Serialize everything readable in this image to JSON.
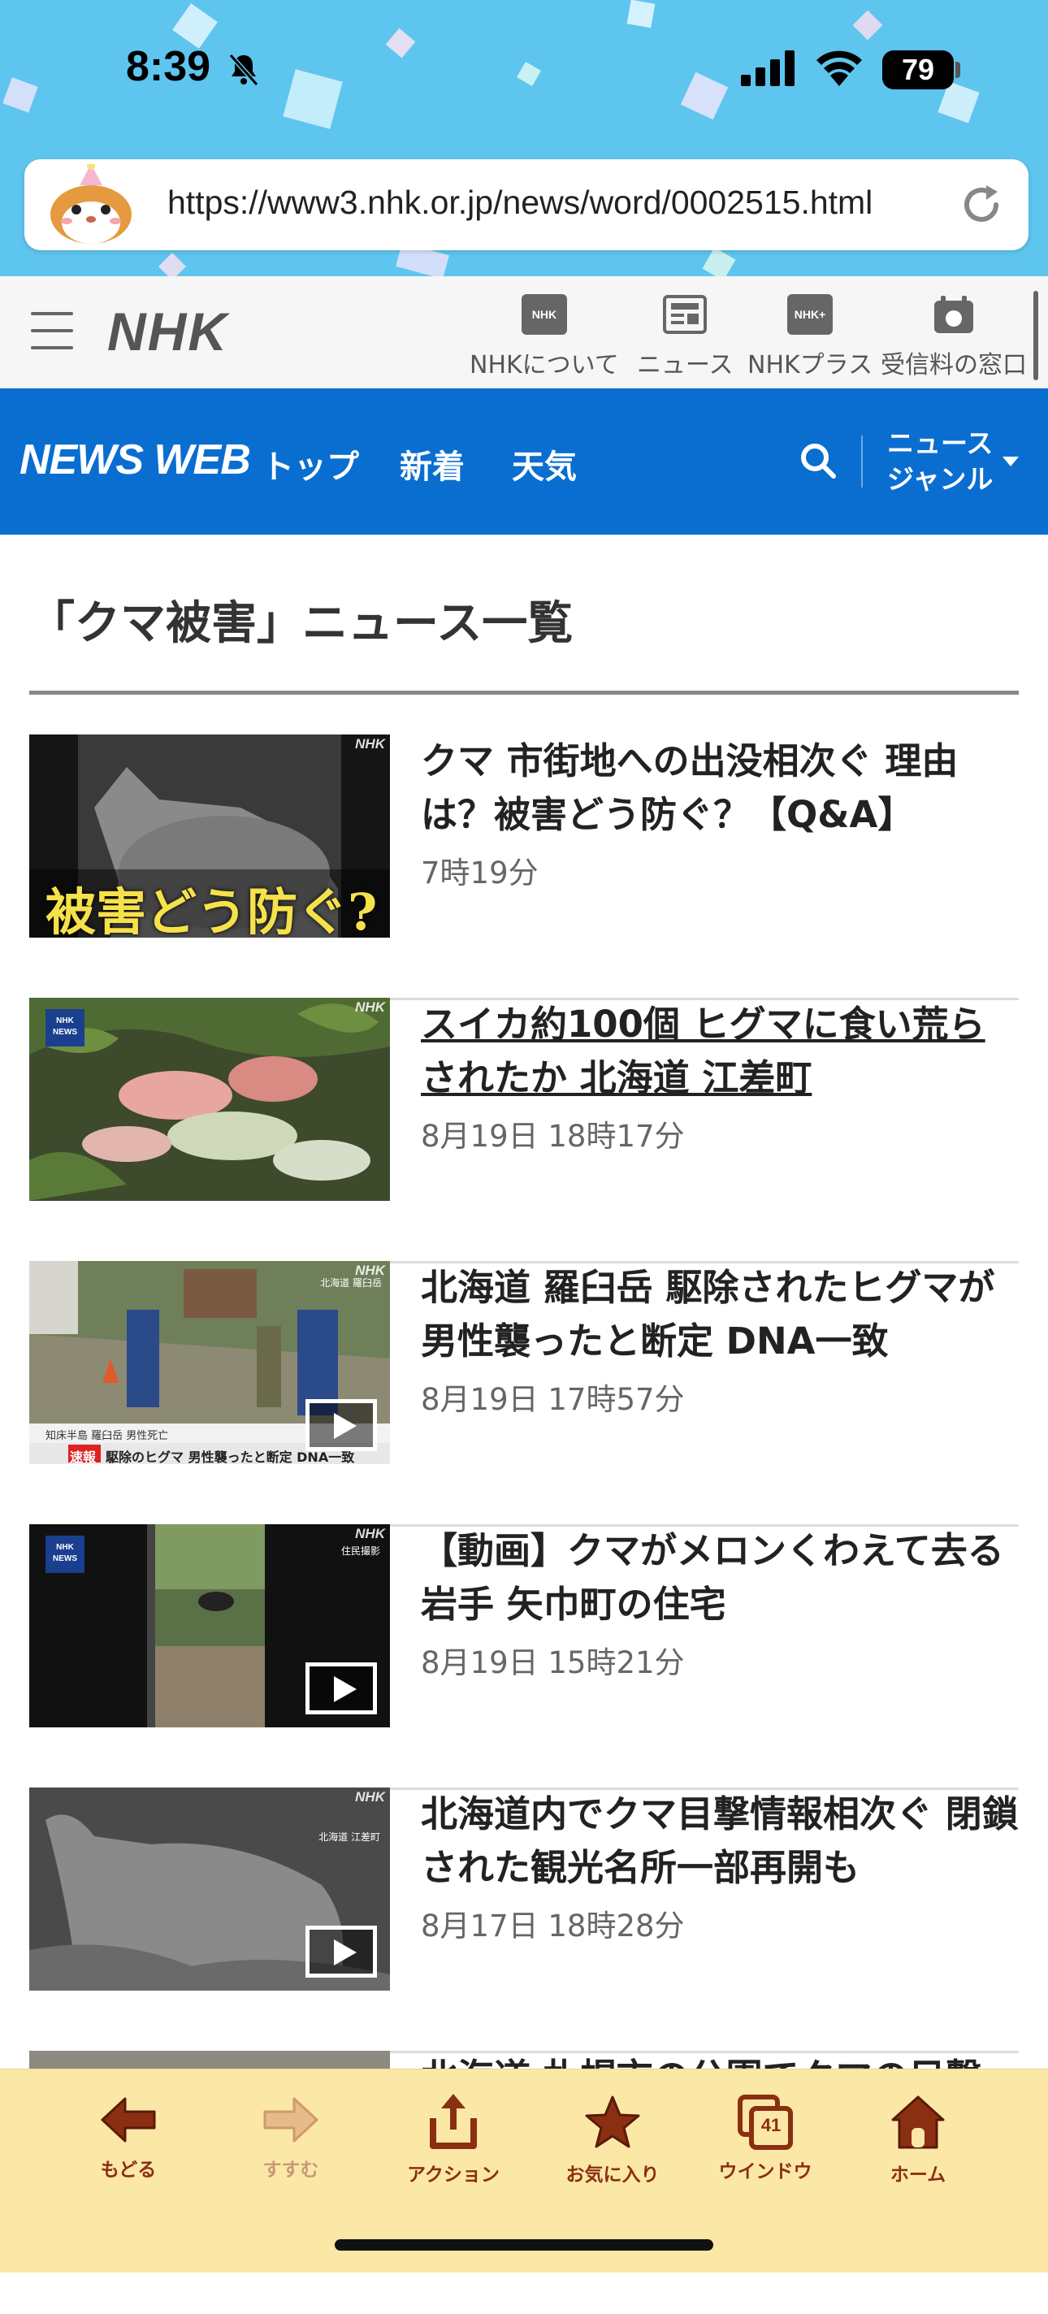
{
  "status_bar": {
    "time": "8:39",
    "battery": "79",
    "icons": [
      "bell-slash-icon",
      "cellular-signal-icon",
      "wifi-icon",
      "battery-icon"
    ]
  },
  "browser": {
    "url": "https://www3.nhk.or.jp/news/word/0002515.html",
    "reload_icon": "reload-icon"
  },
  "nhk_header": {
    "logo": "NHK",
    "nav": [
      {
        "label": "NHKについて",
        "icon_text": "NHK"
      },
      {
        "label": "ニュース",
        "icon_text": ""
      },
      {
        "label": "NHKプラス",
        "icon_text": "NHK+"
      },
      {
        "label": "受信料の窓口",
        "icon_text": ""
      }
    ]
  },
  "newsweb": {
    "logo": "NEWS WEB",
    "links": [
      "トップ",
      "新着",
      "天気"
    ],
    "genre_line1": "ニュース",
    "genre_line2": "ジャンル"
  },
  "page": {
    "title": "「クマ被害」ニュース一覧"
  },
  "thumb_texts": {
    "nhk": "NHK",
    "t1_caption": "被害どう防ぐ?",
    "t3_location": "知床半島 羅臼岳 男性死亡",
    "t3_flash": "速報",
    "t3_ticker": "駆除のヒグマ 男性襲ったと断定 DNA一致",
    "t3_corner": "北海道 羅臼岳",
    "t4_corner": "住民撮影",
    "t5_corner": "北海道 江差町"
  },
  "articles": [
    {
      "title": "クマ 市街地への出没相次ぐ 理由は？被害どう防ぐ？【Q&A】",
      "time": "7時19分",
      "visited": false
    },
    {
      "title": "スイカ約100個 ヒグマに食い荒らされたか 北海道 江差町",
      "time": "8月19日 18時17分",
      "visited": true
    },
    {
      "title": "北海道 羅臼岳 駆除されたヒグマが男性襲ったと断定 DNA一致",
      "time": "8月19日 17時57分",
      "visited": false
    },
    {
      "title": "【動画】クマがメロンくわえて去る 岩手 矢巾町の住宅",
      "time": "8月19日 15時21分",
      "visited": false
    },
    {
      "title": "北海道内でクマ目撃情報相次ぐ 閉鎖された観光名所一部再開も",
      "time": "8月17日 18時28分",
      "visited": false
    }
  ],
  "partial_article": {
    "title": "北海道 札幌市の公園でクマの目撃"
  },
  "toolbar": {
    "back": "もどる",
    "forward": "すすむ",
    "action": "アクション",
    "favorites": "お気に入り",
    "windows": "ウインドウ",
    "windows_count": "41",
    "home": "ホーム"
  },
  "colors": {
    "chrome_bg": "#5ec5ef",
    "newsweb_bg": "#0a6ed1",
    "toolbar_bg": "#fbe8a6",
    "toolbar_icon": "#8a2f12"
  }
}
